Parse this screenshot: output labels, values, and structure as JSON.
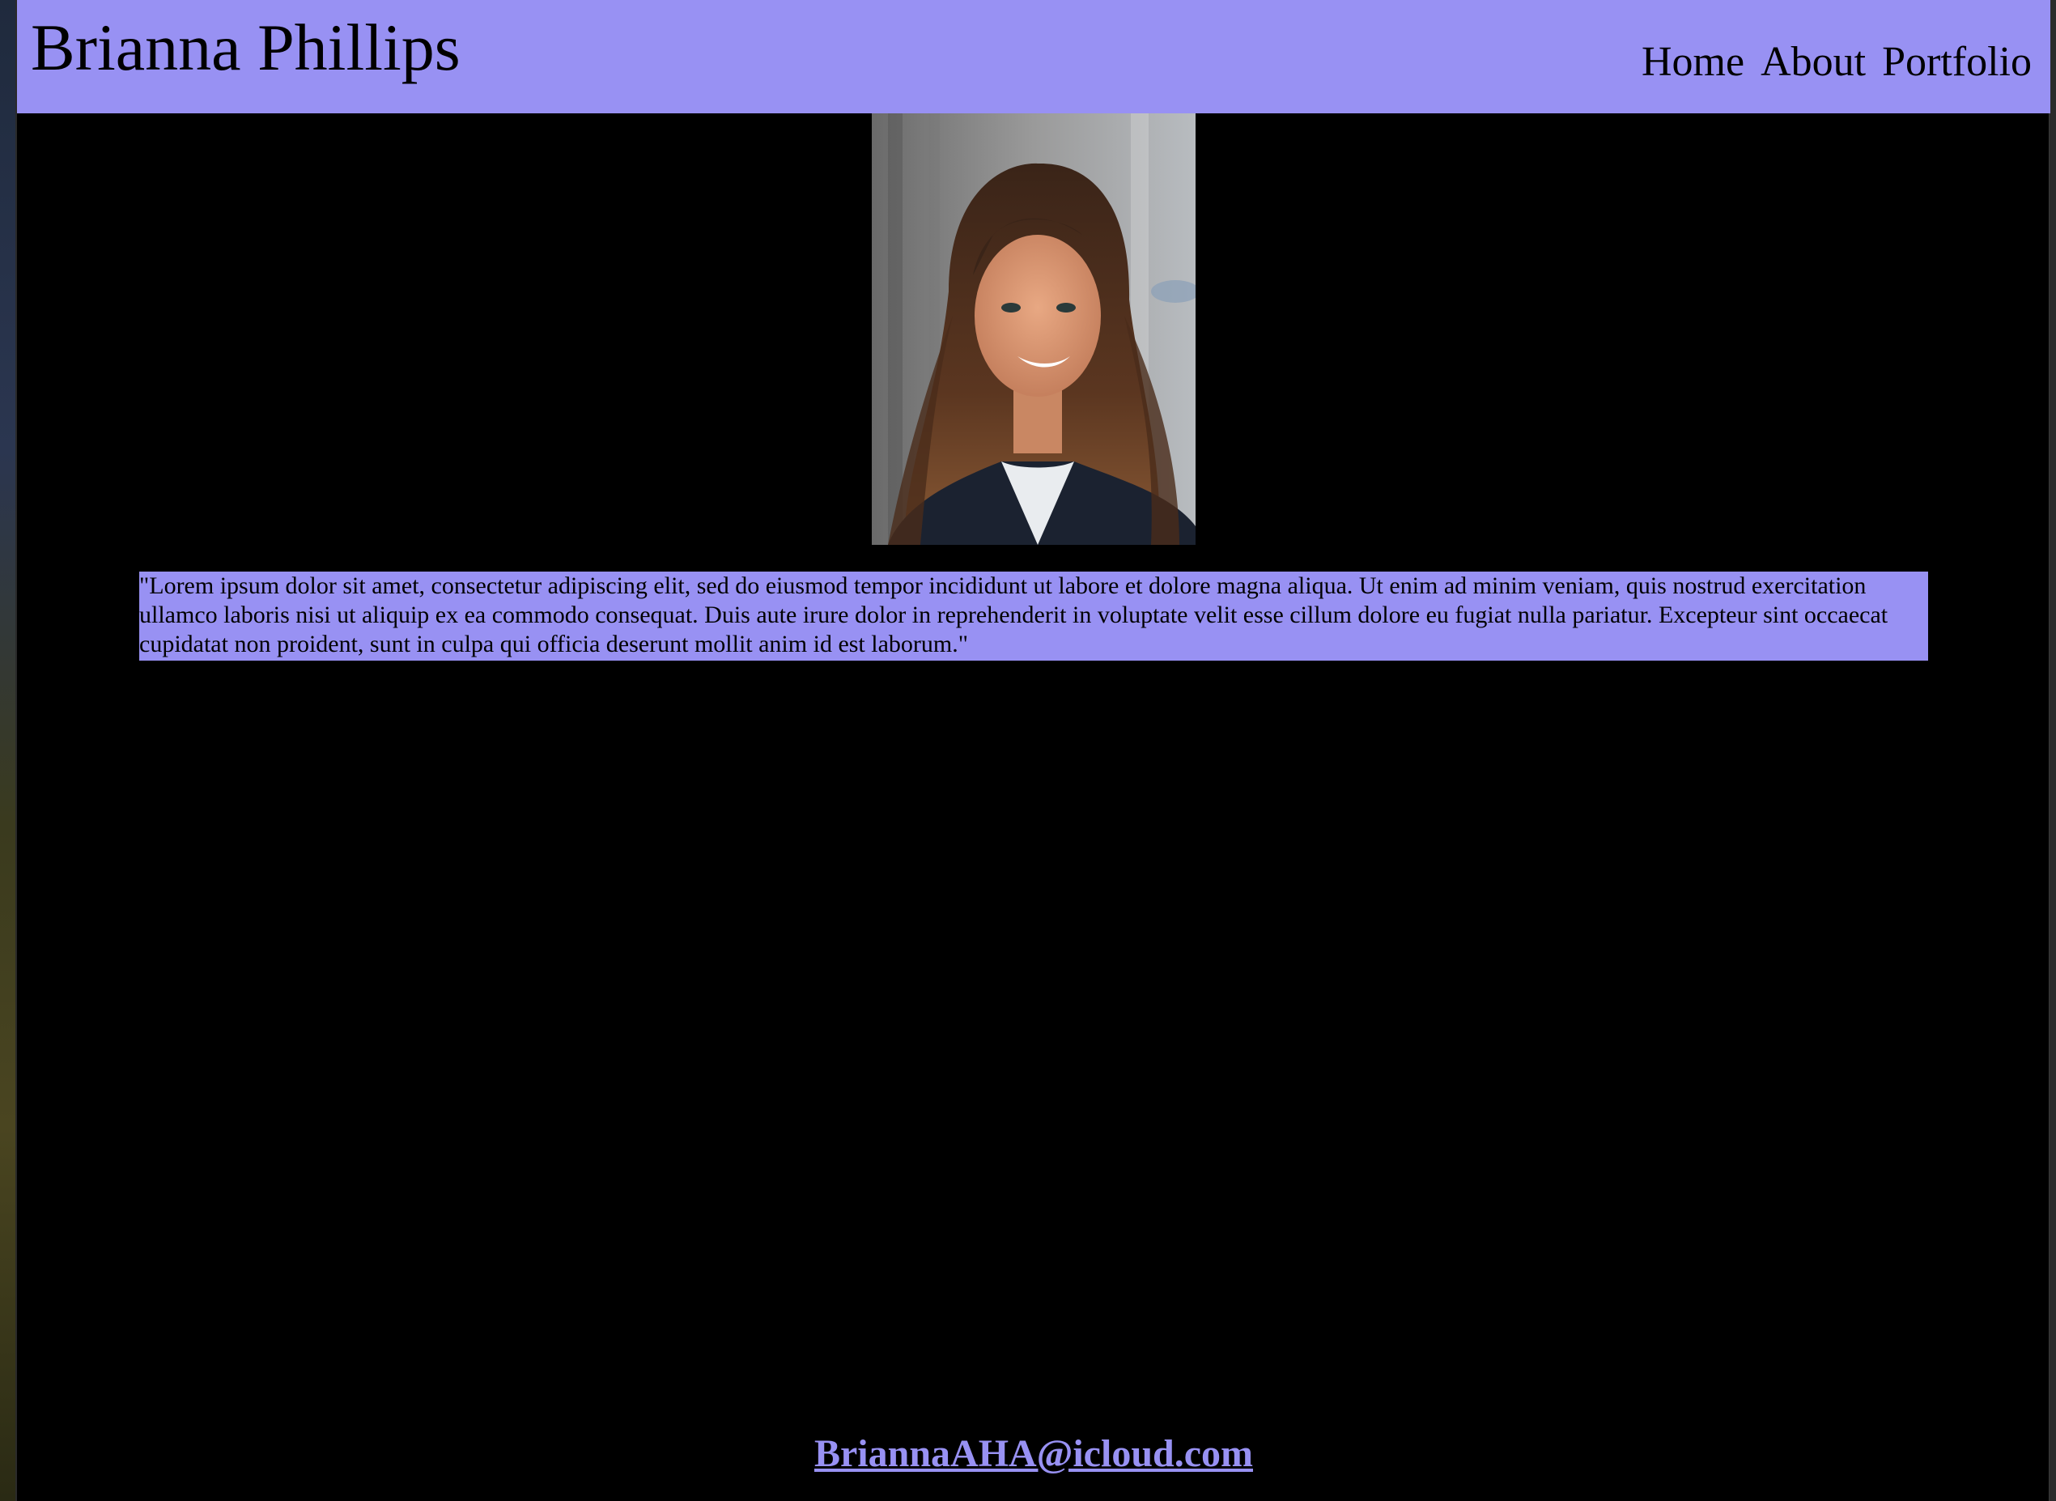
{
  "header": {
    "title": "Brianna Phillips",
    "nav": {
      "home": "Home",
      "about": "About",
      "portfolio": "Portfolio"
    }
  },
  "main": {
    "bio": "\"Lorem ipsum dolor sit amet, consectetur adipiscing elit, sed do eiusmod tempor incididunt ut labore et dolore magna aliqua. Ut enim ad minim veniam, quis nostrud exercitation ullamco laboris nisi ut aliquip ex ea commodo consequat. Duis aute irure dolor in reprehenderit in voluptate velit esse cillum dolore eu fugiat nulla pariatur. Excepteur sint occaecat cupidatat non proident, sunt in culpa qui officia deserunt mollit anim id est laborum.\""
  },
  "footer": {
    "email": "BriannaAHA@icloud.com"
  },
  "colors": {
    "accent": "#9891f3",
    "background": "#000000",
    "text": "#000000"
  }
}
